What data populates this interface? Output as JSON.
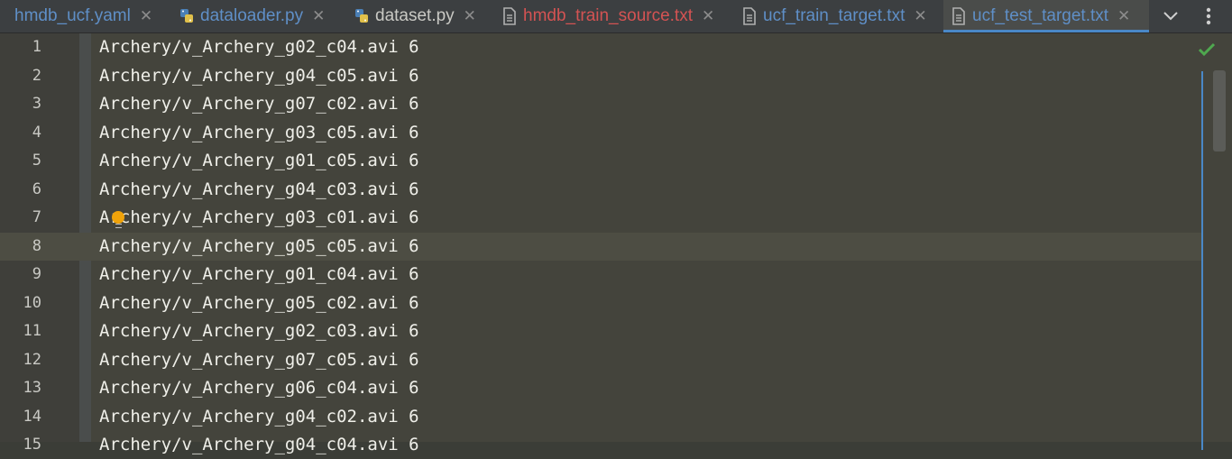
{
  "tabs": [
    {
      "name": "hmdb_ucf.yaml",
      "icon": "yaml-file-icon",
      "color": "#5f8fc7",
      "close": "✕",
      "active": false
    },
    {
      "name": "dataloader.py",
      "icon": "python-file-icon",
      "color": "#5f8fc7",
      "close": "✕",
      "active": false
    },
    {
      "name": "dataset.py",
      "icon": "python-file-icon",
      "color": "#c9c9c4",
      "close": "✕",
      "active": false
    },
    {
      "name": "hmdb_train_source.txt",
      "icon": "text-file-icon",
      "color": "#d45353",
      "close": "✕",
      "active": false
    },
    {
      "name": "ucf_train_target.txt",
      "icon": "text-file-icon",
      "color": "#5f8fc7",
      "close": "✕",
      "active": false
    },
    {
      "name": "ucf_test_target.txt",
      "icon": "text-file-icon",
      "color": "#5f8fc7",
      "close": "✕",
      "active": true
    }
  ],
  "toolbar": {
    "dropdown_icon": "chevron-down-icon",
    "more_icon": "vertical-dots-icon"
  },
  "editor": {
    "current_line": 8,
    "inspection_status_icon": "checkmark-icon",
    "lines": [
      {
        "no": "1",
        "text": "Archery/v_Archery_g02_c04.avi 6"
      },
      {
        "no": "2",
        "text": "Archery/v_Archery_g04_c05.avi 6"
      },
      {
        "no": "3",
        "text": "Archery/v_Archery_g07_c02.avi 6"
      },
      {
        "no": "4",
        "text": "Archery/v_Archery_g03_c05.avi 6"
      },
      {
        "no": "5",
        "text": "Archery/v_Archery_g01_c05.avi 6"
      },
      {
        "no": "6",
        "text": "Archery/v_Archery_g04_c03.avi 6"
      },
      {
        "no": "7",
        "text": "Archery/v_Archery_g03_c01.avi 6"
      },
      {
        "no": "8",
        "text": "Archery/v_Archery_g05_c05.avi 6"
      },
      {
        "no": "9",
        "text": "Archery/v_Archery_g01_c04.avi 6"
      },
      {
        "no": "10",
        "text": "Archery/v_Archery_g05_c02.avi 6"
      },
      {
        "no": "11",
        "text": "Archery/v_Archery_g02_c03.avi 6"
      },
      {
        "no": "12",
        "text": "Archery/v_Archery_g07_c05.avi 6"
      },
      {
        "no": "13",
        "text": "Archery/v_Archery_g06_c04.avi 6"
      },
      {
        "no": "14",
        "text": "Archery/v_Archery_g04_c02.avi 6"
      },
      {
        "no": "15",
        "text": "Archery/v_Archery_g04_c04.avi 6"
      }
    ]
  },
  "colors": {
    "accent": "#4a88c7",
    "text": "#efefe9",
    "intention_bulb": "#f0a30a",
    "ok_check": "#4fa84f"
  }
}
